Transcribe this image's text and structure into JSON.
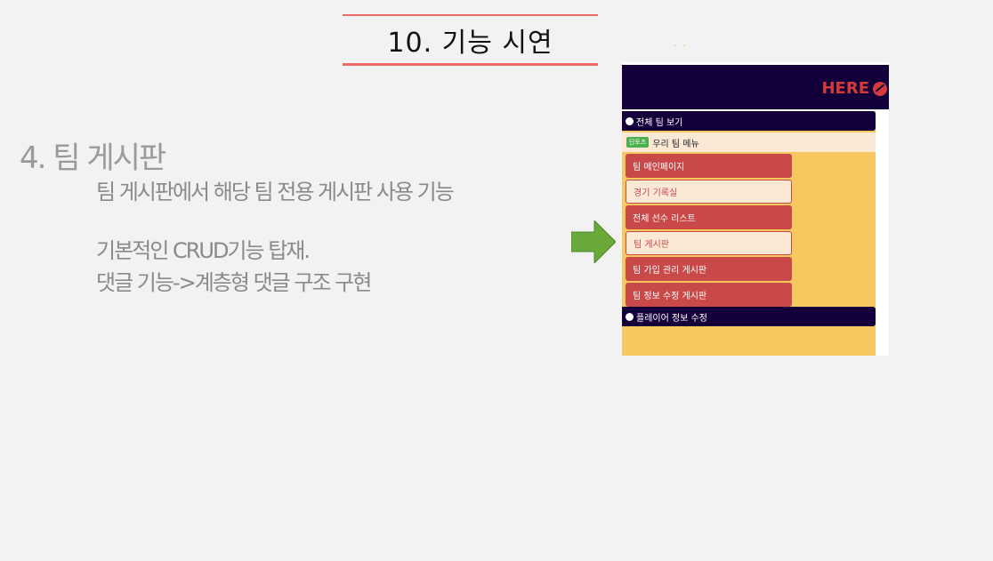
{
  "slide": {
    "title": "10. 기능 시연",
    "section_title": "4. 팀 게시판",
    "lines": [
      "팀 게시판에서 해당 팀 전용 게시판 사용 기능",
      "기본적인 CRUD기능 탑재.",
      "댓글 기능->계층형 댓글 구조 구현"
    ],
    "dots": ". ."
  },
  "screenshot": {
    "logo_text": "HERE",
    "all_teams": "전체 팀 보기",
    "team_badge": "단토즈",
    "our_team_menu": "우리 팀 메뉴",
    "menu": [
      "팀 메인페이지",
      "경기 기록실",
      "전체 선수 리스트",
      "팀 게시판",
      "팀 가입 관리 게시판",
      "팀 정보 수정 게시판"
    ],
    "player_edit": "플레이어 정보 수정"
  },
  "colors": {
    "accent_line": "#f06a6a",
    "header_navy": "#13003b",
    "sidebar_yellow": "#f7c85f",
    "menu_red": "#c94848",
    "arrow_green": "#6aa83a"
  }
}
